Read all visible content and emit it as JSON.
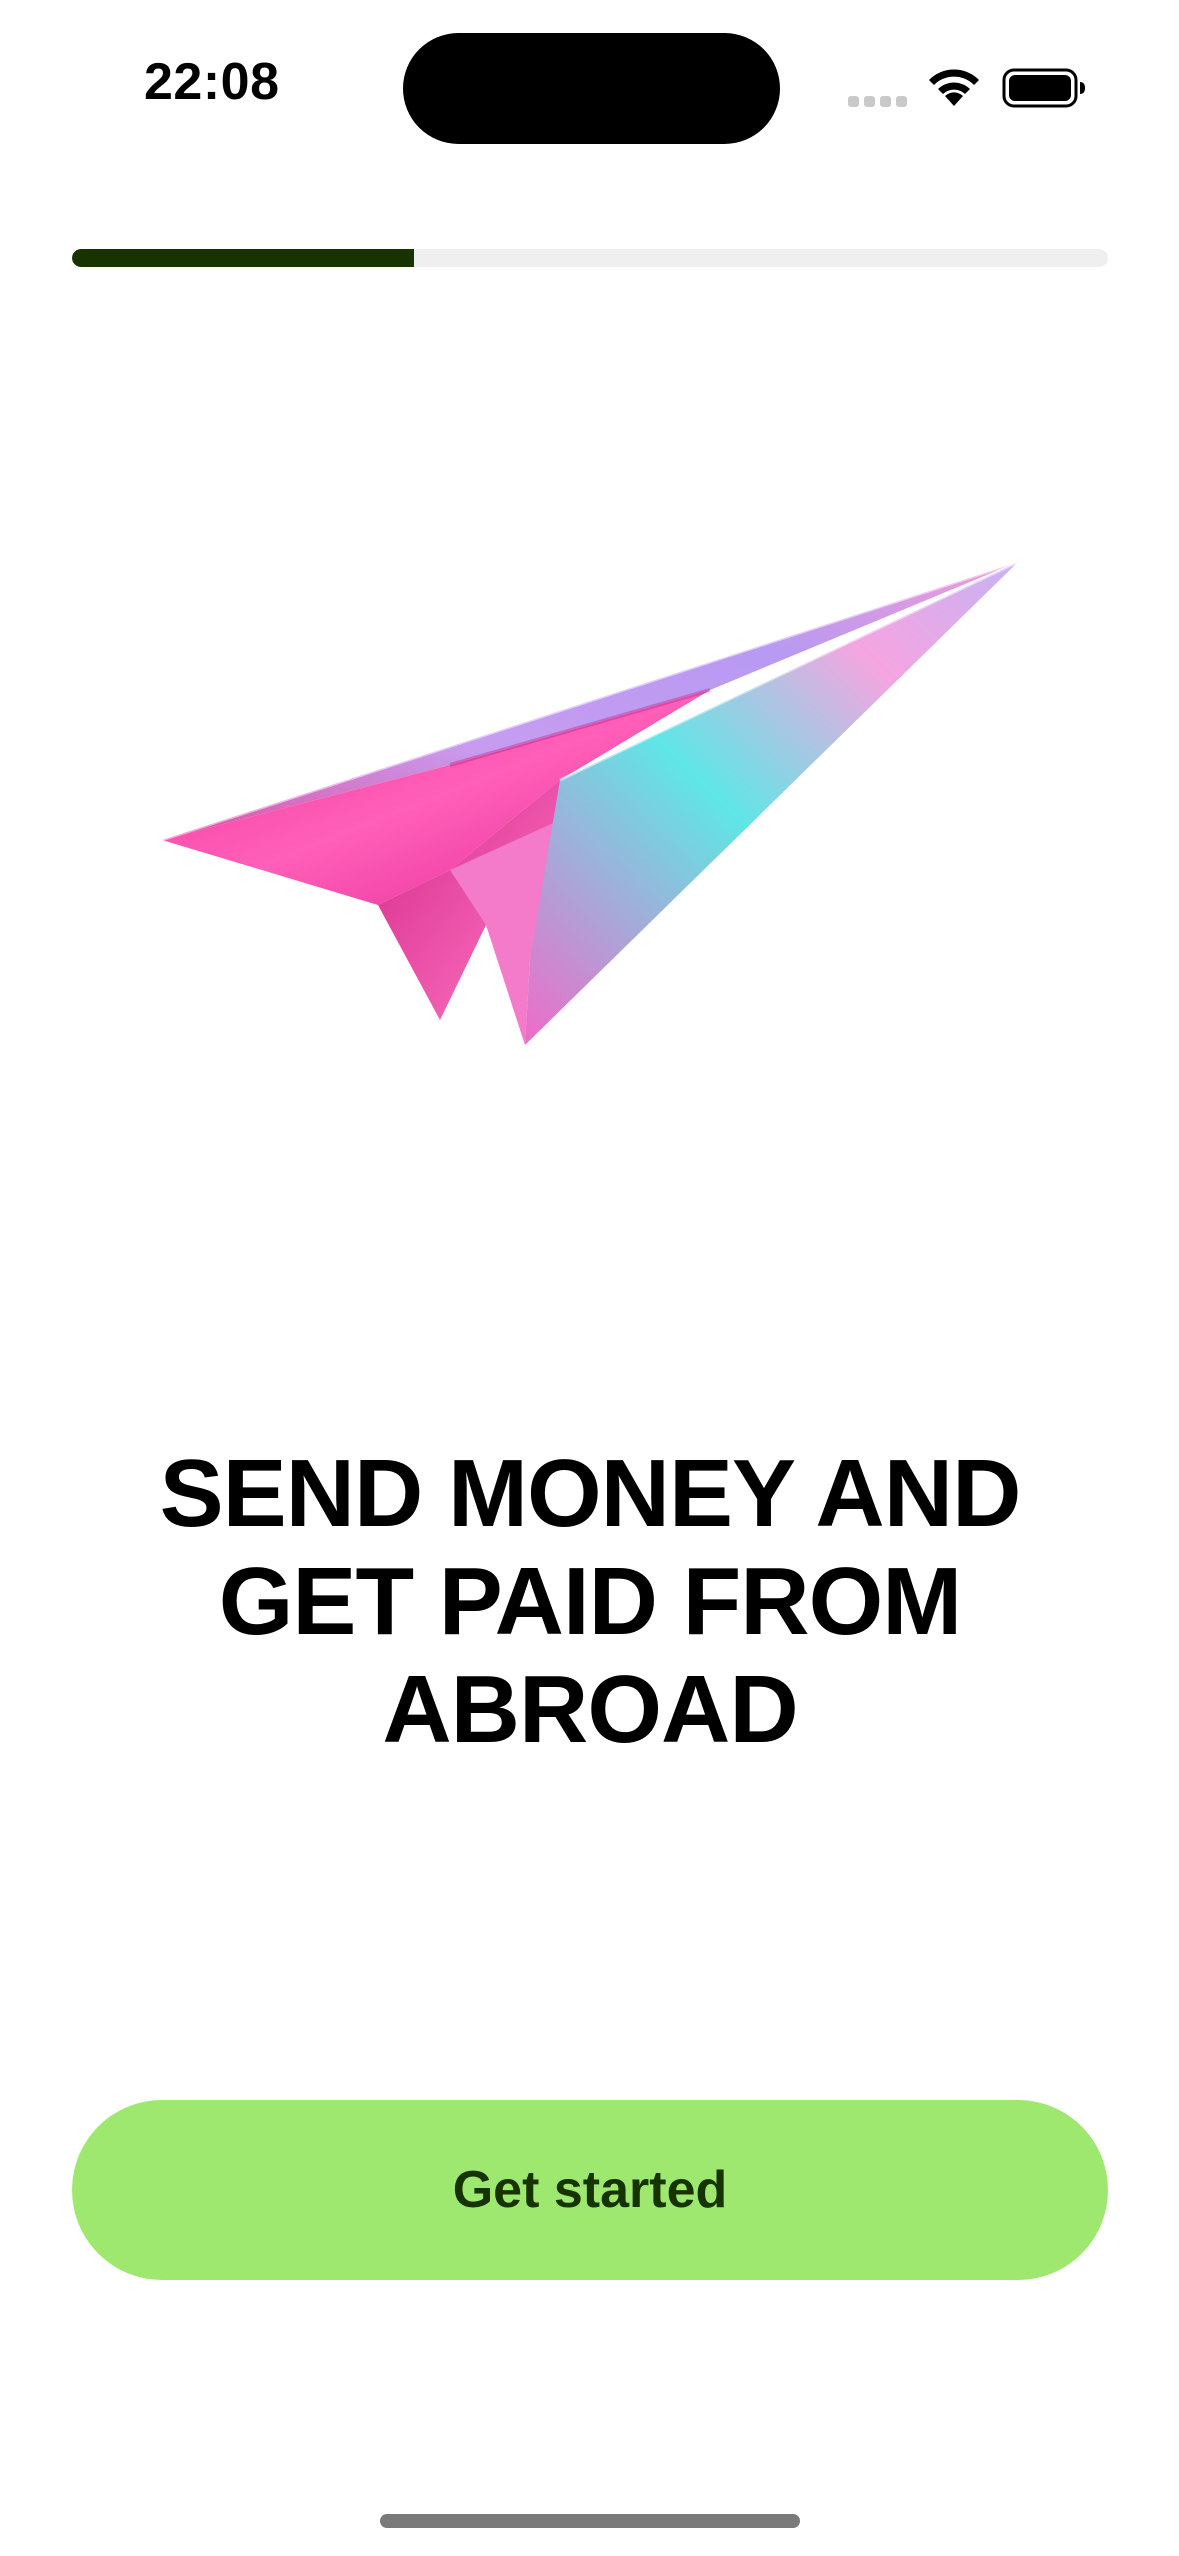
{
  "status_bar": {
    "time": "22:08",
    "icons": [
      "cellular-signal-icon",
      "wifi-icon",
      "battery-icon"
    ]
  },
  "onboarding": {
    "progress": 0.33,
    "illustration": "paper-plane-illustration",
    "headline": "SEND MONEY AND GET PAID FROM ABROAD",
    "cta_label": "Get started"
  },
  "colors": {
    "progress_fill": "#163300",
    "progress_track": "#efefef",
    "cta_background": "#9fe870",
    "cta_text": "#163300",
    "headline_text": "#000000",
    "plane_pink": "#f0359a",
    "plane_lilac": "#c79cf0",
    "plane_cyan": "#5fe6e6"
  }
}
